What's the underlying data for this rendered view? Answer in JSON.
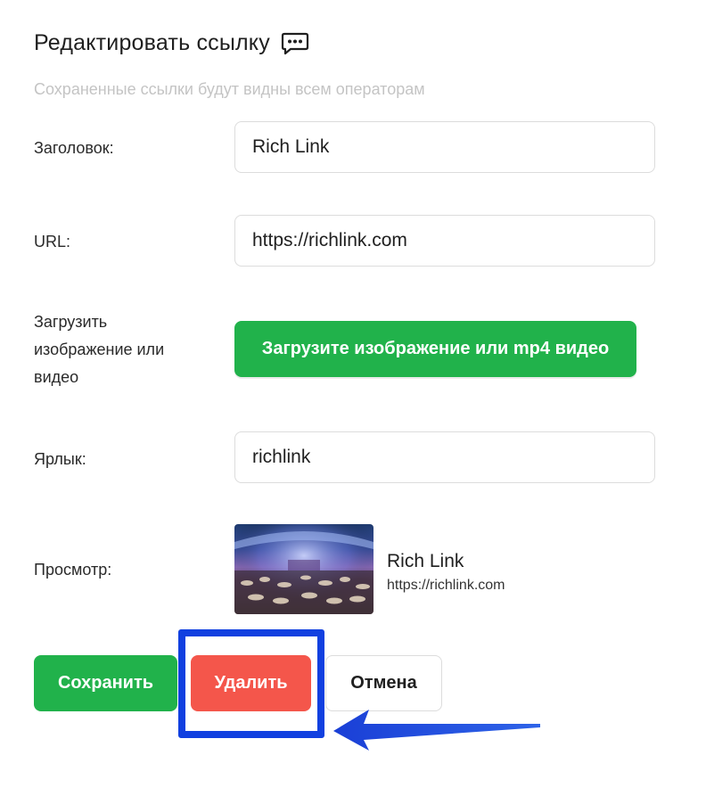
{
  "dialog": {
    "title": "Редактировать ссылку",
    "title_icon": "chat-dots-icon",
    "subtitle": "Сохраненные ссылки будут видны всем операторам"
  },
  "form": {
    "title_label": "Заголовок:",
    "title_value": "Rich Link",
    "url_label": "URL:",
    "url_value": "https://richlink.com",
    "upload_label_line1": "Загрузить",
    "upload_label_line2": "изображение или",
    "upload_label_line3": "видео",
    "upload_button": "Загрузите изображение или mp4 видео",
    "shortcut_label": "Ярлык:",
    "shortcut_value": "richlink",
    "preview_label": "Просмотр:",
    "preview_title": "Rich Link",
    "preview_url": "https://richlink.com"
  },
  "actions": {
    "save": "Сохранить",
    "delete": "Удалить",
    "cancel": "Отмена"
  },
  "colors": {
    "primary_green": "#21b24b",
    "danger_red": "#f4564b",
    "annotation_blue": "#1140e0"
  }
}
